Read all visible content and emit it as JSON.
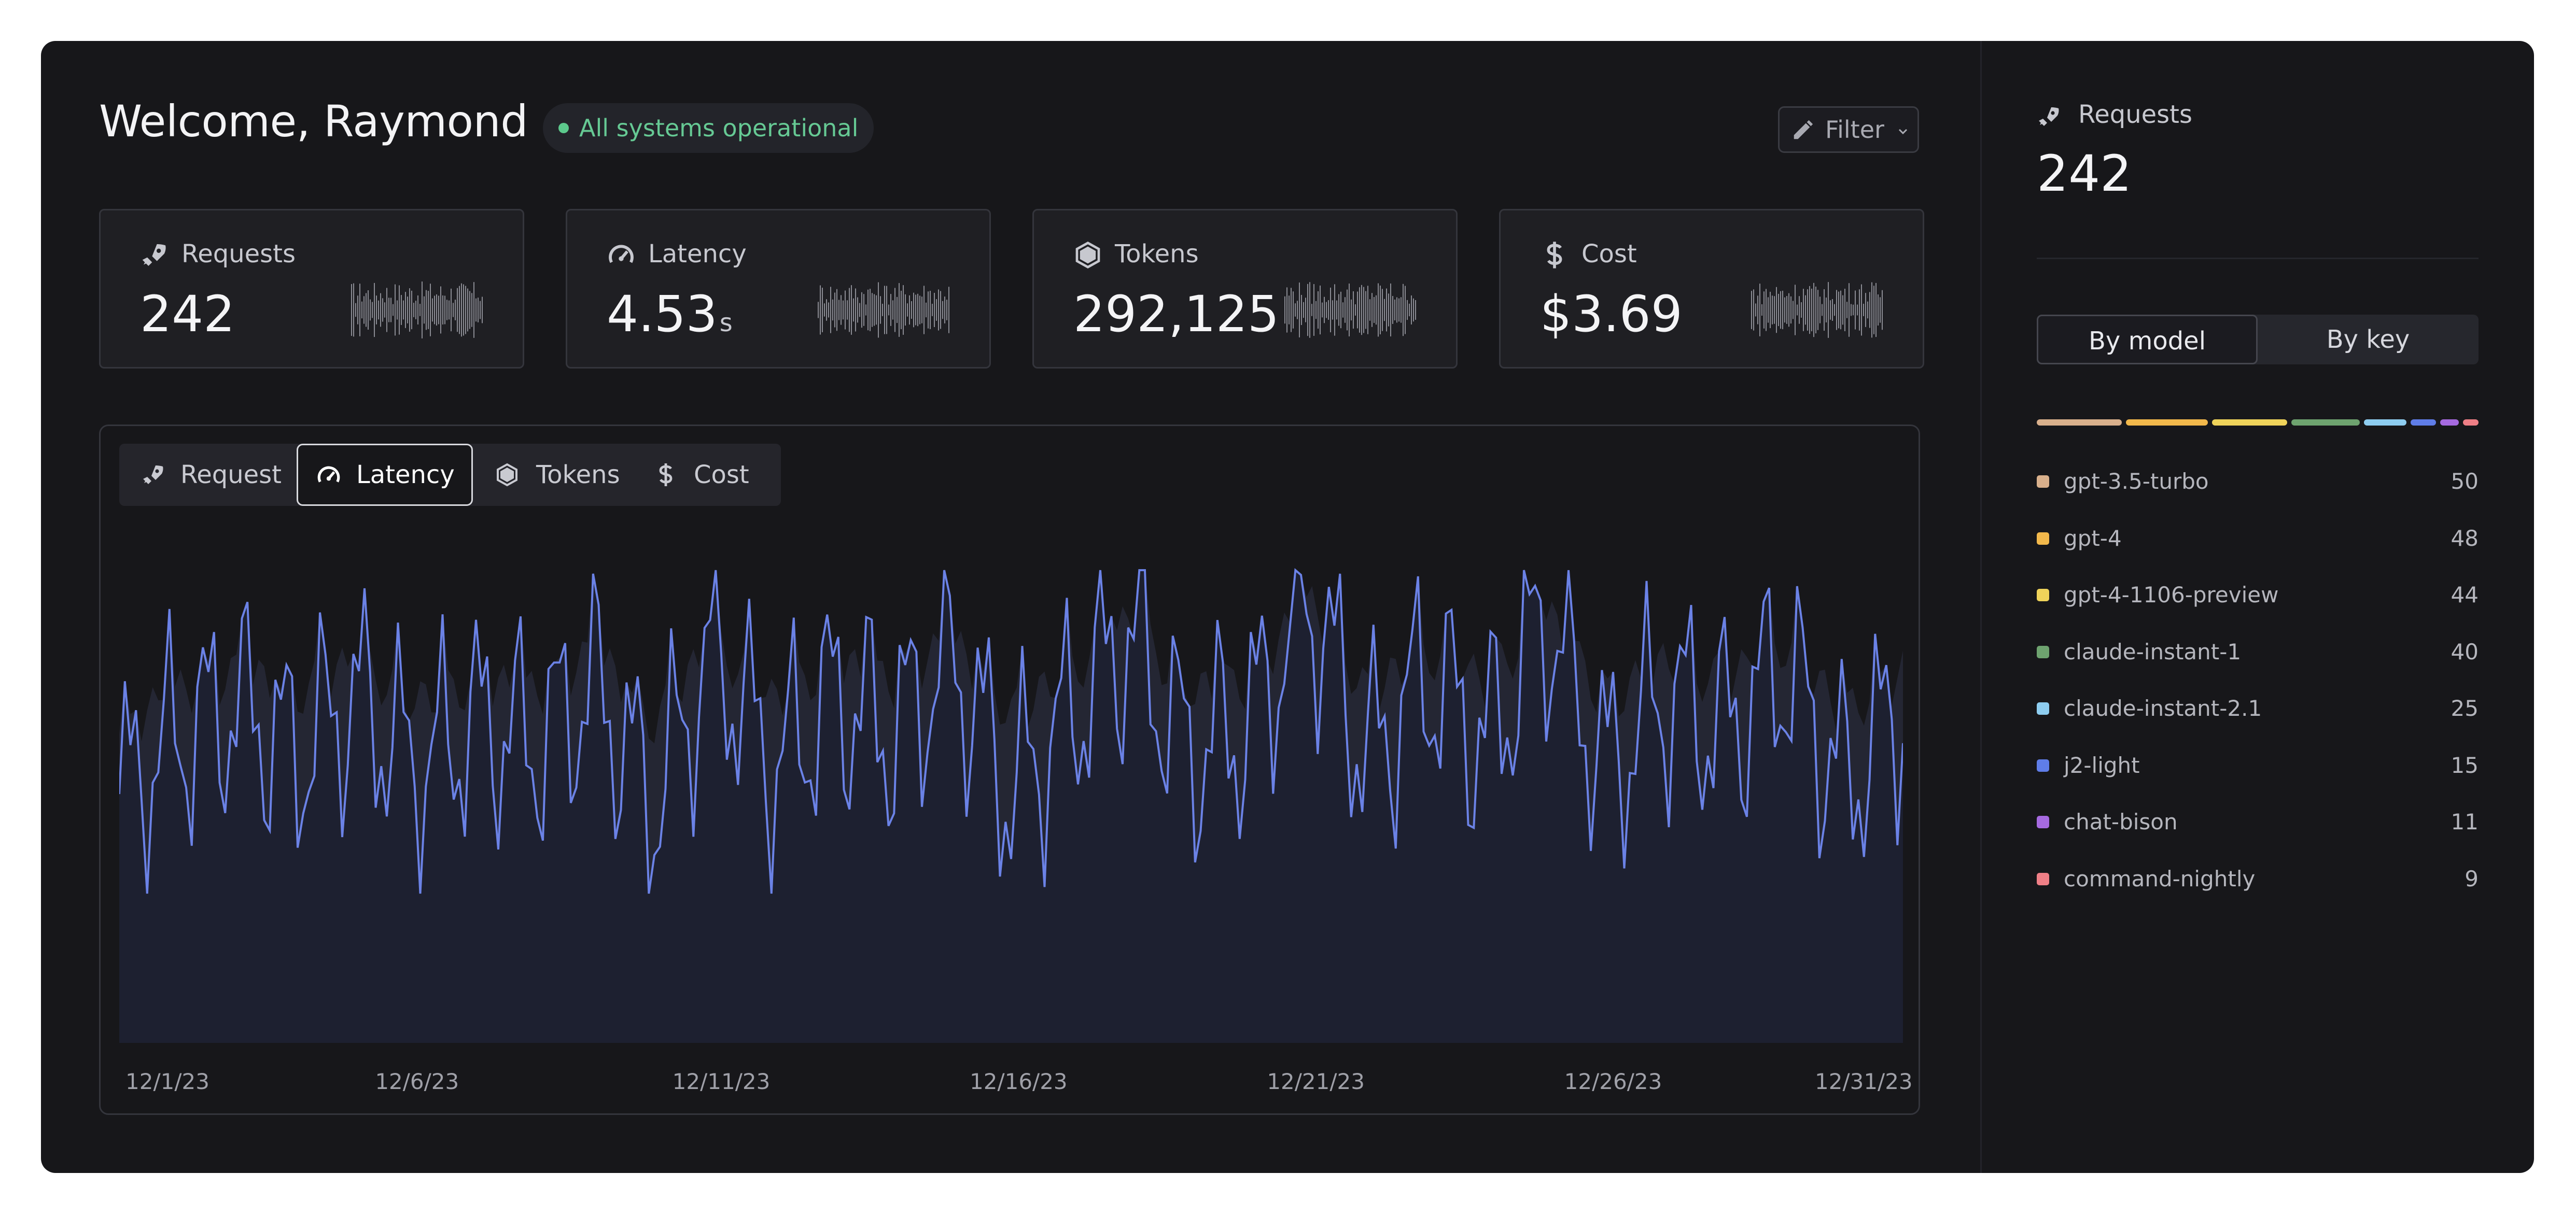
{
  "header": {
    "title": "Welcome, Raymond",
    "status": "All systems operational",
    "filter_label": "Filter"
  },
  "cards": [
    {
      "label": "Requests",
      "value": "242",
      "unit": "",
      "icon": "rocket-icon"
    },
    {
      "label": "Latency",
      "value": "4.53",
      "unit": "s",
      "icon": "speedometer-icon"
    },
    {
      "label": "Tokens",
      "value": "292,125",
      "unit": "",
      "icon": "hexagon-icon"
    },
    {
      "label": "Cost",
      "value": "$3.69",
      "unit": "",
      "icon": "dollar-icon"
    }
  ],
  "chart": {
    "tabs": [
      "Request",
      "Latency",
      "Tokens",
      "Cost"
    ],
    "active_tab": "Latency",
    "x_labels": [
      "12/1/23",
      "12/6/23",
      "12/11/23",
      "12/16/23",
      "12/21/23",
      "12/26/23",
      "12/31/23"
    ]
  },
  "chart_data": {
    "type": "line",
    "title": "",
    "xlabel": "",
    "ylabel": "",
    "x": [
      "12/1/23",
      "12/6/23",
      "12/11/23",
      "12/16/23",
      "12/21/23",
      "12/26/23",
      "12/31/23"
    ],
    "series": [
      {
        "values": [
          0.5,
          0.62,
          0.68,
          0.58,
          0.7,
          0.55,
          0.65,
          0.6,
          0.72,
          0.48,
          0.8,
          0.55,
          0.7,
          0.62,
          0.78,
          0.5,
          0.66,
          0.82,
          0.58,
          0.64,
          0.9,
          0.57,
          0.74,
          0.6,
          0.86,
          0.55,
          0.7,
          0.63,
          0.76,
          0.52,
          0.68
        ]
      },
      {
        "values": [
          0.62,
          0.7,
          0.74,
          0.7,
          0.76,
          0.68,
          0.72,
          0.7,
          0.78,
          0.64,
          0.8,
          0.68,
          0.76,
          0.72,
          0.8,
          0.66,
          0.74,
          0.84,
          0.7,
          0.72,
          0.88,
          0.7,
          0.78,
          0.72,
          0.86,
          0.68,
          0.76,
          0.72,
          0.8,
          0.66,
          0.74
        ]
      }
    ],
    "colors": {
      "line": "#6b82e6",
      "area_upper": "#242633",
      "area_lower": "#1d2030",
      "background": "#17171a"
    }
  },
  "side": {
    "label": "Requests",
    "value": "242",
    "segments": [
      "By model",
      "By key"
    ],
    "active_segment": "By model",
    "models": [
      {
        "name": "gpt-3.5-turbo",
        "count": "50",
        "color": "#d9b08c"
      },
      {
        "name": "gpt-4",
        "count": "48",
        "color": "#f2b84b"
      },
      {
        "name": "gpt-4-1106-preview",
        "count": "44",
        "color": "#efd35a"
      },
      {
        "name": "claude-instant-1",
        "count": "40",
        "color": "#6ea36f"
      },
      {
        "name": "claude-instant-2.1",
        "count": "25",
        "color": "#8ecdf0"
      },
      {
        "name": "j2-light",
        "count": "15",
        "color": "#5f7de8"
      },
      {
        "name": "chat-bison",
        "count": "11",
        "color": "#a66ae0"
      },
      {
        "name": "command-nightly",
        "count": "9",
        "color": "#ef7f86"
      }
    ]
  }
}
